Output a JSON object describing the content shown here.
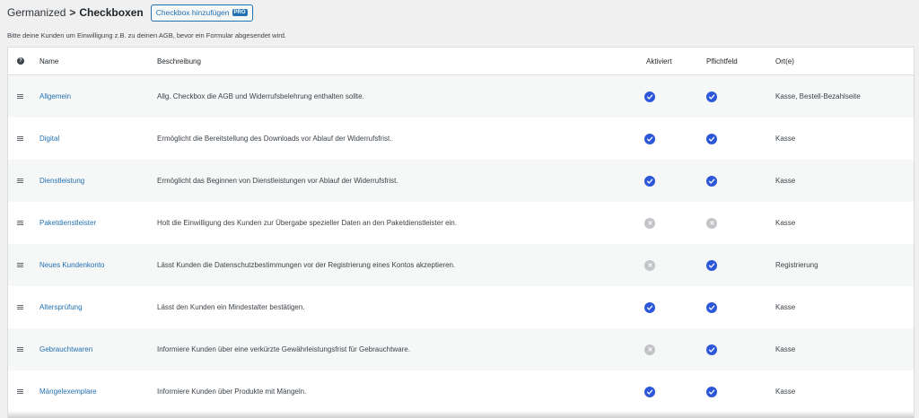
{
  "header": {
    "breadcrumb_root": "Germanized",
    "breadcrumb_sep": ">",
    "title": "Checkboxen",
    "add_button_label": "Checkbox hinzufügen",
    "pro_badge": "PRO"
  },
  "description": "Bitte deine Kunden um Einwilligung z.B. zu deinen AGB, bevor ein Formular abgesendet wird.",
  "table": {
    "help_icon": "?",
    "columns": {
      "name": "Name",
      "description": "Beschreibung",
      "active": "Aktiviert",
      "required": "Pflichtfeld",
      "location": "Ort(e)"
    },
    "rows": [
      {
        "name": "Allgemein",
        "description": "Allg. Checkbox die AGB und Widerrufsbelehrung enthalten sollte.",
        "active": true,
        "required": true,
        "location": "Kasse, Bestell-Bezahlseite"
      },
      {
        "name": "Digital",
        "description": "Ermöglicht die Bereitstellung des Downloads vor Ablauf der Widerrufsfrist.",
        "active": true,
        "required": true,
        "location": "Kasse"
      },
      {
        "name": "Dienstleistung",
        "description": "Ermöglicht das Beginnen von Dienstleistungen vor Ablauf der Widerrufsfrist.",
        "active": true,
        "required": true,
        "location": "Kasse"
      },
      {
        "name": "Paketdienstleister",
        "description": "Holt die Einwilligung des Kunden zur Übergabe spezieller Daten an den Paketdienstleister ein.",
        "active": false,
        "required": false,
        "location": "Kasse"
      },
      {
        "name": "Neues Kundenkonto",
        "description": "Lässt Kunden die Datenschutzbestimmungen vor der Registrierung eines Kontos akzeptieren.",
        "active": false,
        "required": true,
        "location": "Registrierung"
      },
      {
        "name": "Altersprüfung",
        "description": "Lässt den Kunden ein Mindestalter bestätigen.",
        "active": true,
        "required": true,
        "location": "Kasse"
      },
      {
        "name": "Gebrauchtwaren",
        "description": "Informiere Kunden über eine verkürzte Gewährleistungsfrist für Gebrauchtware.",
        "active": false,
        "required": true,
        "location": "Kasse"
      },
      {
        "name": "Mängelexemplare",
        "description": "Informiere Kunden über Produkte mit Mängeln.",
        "active": true,
        "required": true,
        "location": "Kasse"
      }
    ]
  },
  "icons": {
    "drag": "drag-handle-icon",
    "check": "check-circle-icon",
    "disabled": "x-circle-icon",
    "help": "help-icon"
  },
  "colors": {
    "link": "#2271b1",
    "check_active": "#2c57d8",
    "check_inactive": "#c3c4c7"
  }
}
